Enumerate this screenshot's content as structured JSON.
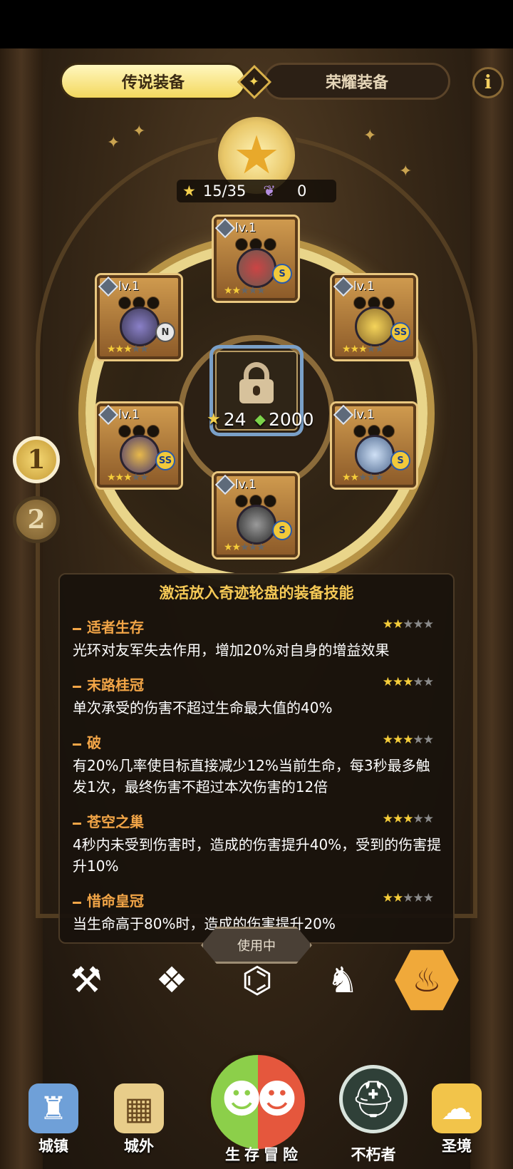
{
  "tabs": {
    "legend": "传说装备",
    "glory": "荣耀装备",
    "divider_icon": "star-icon",
    "info": "i"
  },
  "counter": {
    "stars": "15/35",
    "wings": "0"
  },
  "medallion_icon": "★",
  "lock": {
    "star_cost": "24",
    "gem_cost": "2000"
  },
  "slots": [
    {
      "name": "slot-top",
      "level": "lv.1",
      "grade": "S",
      "stars": 2
    },
    {
      "name": "slot-upper-left",
      "level": "lv.1",
      "grade": "N",
      "stars": 3
    },
    {
      "name": "slot-upper-right",
      "level": "lv.1",
      "grade": "SS",
      "stars": 3
    },
    {
      "name": "slot-lower-left",
      "level": "lv.1",
      "grade": "SS",
      "stars": 3
    },
    {
      "name": "slot-lower-right",
      "level": "lv.1",
      "grade": "S",
      "stars": 2
    },
    {
      "name": "slot-bottom",
      "level": "lv.1",
      "grade": "S",
      "stars": 2
    }
  ],
  "rank_buttons": [
    "1",
    "2"
  ],
  "panel": {
    "title": "激活放入奇迹轮盘的装备技能",
    "skills": [
      {
        "name": "适者生存",
        "stars": 2,
        "desc": "光环对友军失去作用，增加20%对自身的增益效果"
      },
      {
        "name": "末路桂冠",
        "stars": 3,
        "desc": "单次承受的伤害不超过生命最大值的40%"
      },
      {
        "name": "破",
        "stars": 3,
        "desc": "有20%几率使目标直接减少12%当前生命，每3秒最多触发1次，最终伤害不超过本次伤害的12倍"
      },
      {
        "name": "苍空之巢",
        "stars": 3,
        "desc": "4秒内未受到伤害时，造成的伤害提升40%，受到的伤害提升10%"
      },
      {
        "name": "惜命皇冠",
        "stars": 2,
        "desc": "当生命高于80%时，造成的伤害提升20%"
      }
    ]
  },
  "use_button": "使用中",
  "categories": [
    "axe-icon",
    "shield-icon",
    "rune-icon",
    "dragon-icon",
    "flame-icon"
  ],
  "nav": {
    "town": "城镇",
    "outside": "城外",
    "survival": "生存冒险",
    "immortal": "不朽者",
    "holy": "圣境"
  },
  "colors": {
    "accent": "#f5c956",
    "skill_name": "#f2a547",
    "tab_active": "#f3d85e"
  }
}
